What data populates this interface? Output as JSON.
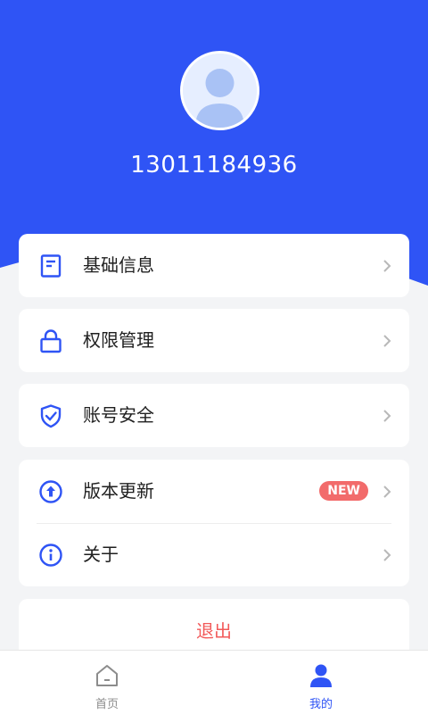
{
  "colors": {
    "primary": "#2F54F5",
    "badge": "#F26B6B",
    "logout": "#F25A5A",
    "tab_inactive": "#8C8C8C"
  },
  "profile": {
    "avatar_icon": "user-avatar-icon",
    "phone": "13011184936"
  },
  "menu": {
    "basic_info": {
      "label": "基础信息",
      "icon": "document-icon"
    },
    "permissions": {
      "label": "权限管理",
      "icon": "lock-icon"
    },
    "account_security": {
      "label": "账号安全",
      "icon": "shield-check-icon"
    },
    "version_update": {
      "label": "版本更新",
      "icon": "upload-arrow-icon",
      "badge": "NEW"
    },
    "about": {
      "label": "关于",
      "icon": "info-icon"
    }
  },
  "logout": {
    "label": "退出"
  },
  "tabbar": {
    "home": {
      "label": "首页",
      "icon": "home-icon",
      "active": false
    },
    "mine": {
      "label": "我的",
      "icon": "person-icon",
      "active": true
    }
  }
}
